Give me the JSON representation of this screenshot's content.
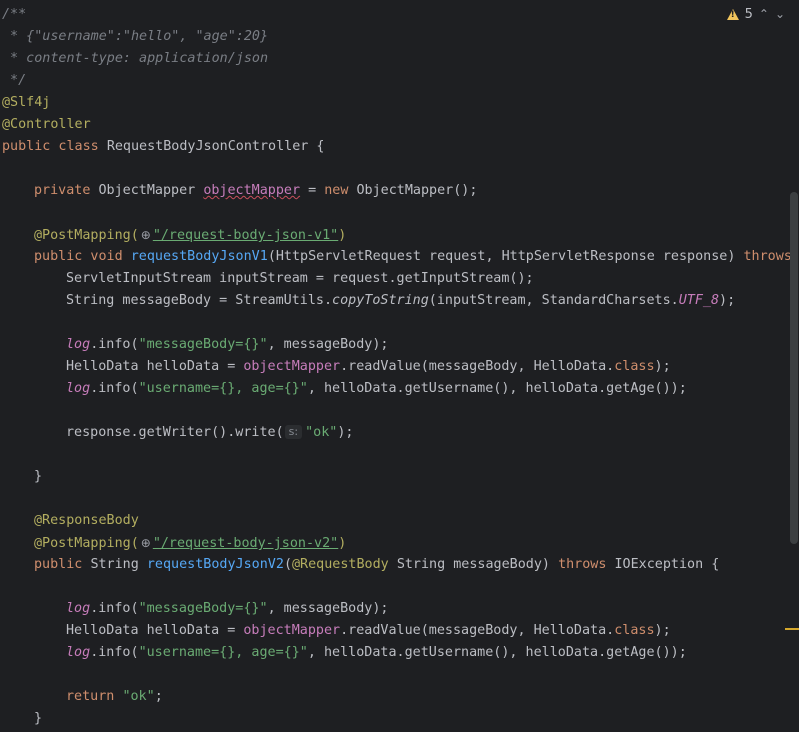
{
  "inspections": {
    "warning_count": "5",
    "up_arrow": "⌃",
    "down_arrow": "⌄"
  },
  "code": {
    "l1": "/**",
    "l2": " * {\"username\":\"hello\", \"age\":20}",
    "l3": " * content-type: application/json",
    "l4": " */",
    "l5": "@Slf4j",
    "l6": "@Controller",
    "l7_kw": "public class ",
    "l7_name": "RequestBodyJsonController {",
    "l9_kw": "private ",
    "l9_type": "ObjectMapper ",
    "l9_field": "objectMapper",
    "l9_eq": " = ",
    "l9_new": "new ",
    "l9_rest": "ObjectMapper();",
    "l11_anno": "@PostMapping(",
    "l11_str": "\"/request-body-json-v1\"",
    "l11_end": ")",
    "l12_kw": "public void ",
    "l12_method": "requestBodyJsonV1",
    "l12_params": "(HttpServletRequest request, HttpServletResponse response) ",
    "l12_throws": "throws I",
    "l13": "ServletInputStream inputStream = request.getInputStream();",
    "l14_a": "String messageBody = StreamUtils.",
    "l14_static": "copyToString",
    "l14_b": "(inputStream, StandardCharsets.",
    "l14_const": "UTF_8",
    "l14_c": ");",
    "log": "log",
    "info_open": ".info(",
    "msg_str": "\"messageBody={}\"",
    "msg_rest": ", messageBody);",
    "hello_a": "HelloData helloData = ",
    "hello_field": "objectMapper",
    "hello_b": ".readValue(messageBody, HelloData.",
    "hello_class": "class",
    "hello_c": ");",
    "user_str": "\"username={}, age={}\"",
    "user_rest": ", helloData.getUsername(), helloData.getAge());",
    "l20_a": "response.getWriter().write(",
    "l20_hint": "s:",
    "l20_str": "\"ok\"",
    "l20_b": ");",
    "close_brace": "}",
    "l25": "@ResponseBody",
    "l26_str": "\"/request-body-json-v2\"",
    "l27_kw": "public ",
    "l27_type": "String ",
    "l27_method": "requestBodyJsonV2",
    "l27_paren": "(",
    "l27_anno": "@RequestBody ",
    "l27_params": "String messageBody) ",
    "l27_throws": "throws ",
    "l27_rest": "IOException {",
    "l33_kw": "return ",
    "l33_str": "\"ok\"",
    "l33_end": ";"
  }
}
